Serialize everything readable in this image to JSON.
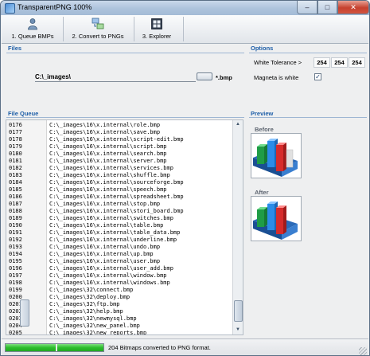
{
  "window": {
    "title": "TransparentPNG 100%"
  },
  "toolbar": {
    "buttons": [
      {
        "label": "1. Queue BMPs",
        "icon": "person-icon"
      },
      {
        "label": "2. Convert to PNGs",
        "icon": "convert-icon"
      },
      {
        "label": "3. Explorer",
        "icon": "explorer-icon"
      }
    ]
  },
  "files": {
    "title": "Files",
    "path_value": "C:\\_images\\",
    "extension": "*.bmp"
  },
  "options": {
    "title": "Options",
    "tolerance_label": "White Tolerance >",
    "tolerance_r": "254",
    "tolerance_g": "254",
    "tolerance_b": "254",
    "magneta_label": "Magneta is white",
    "magneta_checked": true
  },
  "queue": {
    "title": "File Queue",
    "rows": [
      {
        "n": "0176",
        "p": "C:\\_images\\16\\x.internal\\role.bmp"
      },
      {
        "n": "0177",
        "p": "C:\\_images\\16\\x.internal\\save.bmp"
      },
      {
        "n": "0178",
        "p": "C:\\_images\\16\\x.internal\\script-edit.bmp"
      },
      {
        "n": "0179",
        "p": "C:\\_images\\16\\x.internal\\script.bmp"
      },
      {
        "n": "0180",
        "p": "C:\\_images\\16\\x.internal\\search.bmp"
      },
      {
        "n": "0181",
        "p": "C:\\_images\\16\\x.internal\\server.bmp"
      },
      {
        "n": "0182",
        "p": "C:\\_images\\16\\x.internal\\services.bmp"
      },
      {
        "n": "0183",
        "p": "C:\\_images\\16\\x.internal\\shuffle.bmp"
      },
      {
        "n": "0184",
        "p": "C:\\_images\\16\\x.internal\\sourceforge.bmp"
      },
      {
        "n": "0185",
        "p": "C:\\_images\\16\\x.internal\\speech.bmp"
      },
      {
        "n": "0186",
        "p": "C:\\_images\\16\\x.internal\\spreadsheet.bmp"
      },
      {
        "n": "0187",
        "p": "C:\\_images\\16\\x.internal\\stop.bmp"
      },
      {
        "n": "0188",
        "p": "C:\\_images\\16\\x.internal\\stori_board.bmp"
      },
      {
        "n": "0189",
        "p": "C:\\_images\\16\\x.internal\\switches.bmp"
      },
      {
        "n": "0190",
        "p": "C:\\_images\\16\\x.internal\\table.bmp"
      },
      {
        "n": "0191",
        "p": "C:\\_images\\16\\x.internal\\table_data.bmp"
      },
      {
        "n": "0192",
        "p": "C:\\_images\\16\\x.internal\\underline.bmp"
      },
      {
        "n": "0193",
        "p": "C:\\_images\\16\\x.internal\\undo.bmp"
      },
      {
        "n": "0194",
        "p": "C:\\_images\\16\\x.internal\\up.bmp"
      },
      {
        "n": "0195",
        "p": "C:\\_images\\16\\x.internal\\user.bmp"
      },
      {
        "n": "0196",
        "p": "C:\\_images\\16\\x.internal\\user_add.bmp"
      },
      {
        "n": "0197",
        "p": "C:\\_images\\16\\x.internal\\window.bmp"
      },
      {
        "n": "0198",
        "p": "C:\\_images\\16\\x.internal\\windows.bmp"
      },
      {
        "n": "0199",
        "p": "C:\\_images\\32\\connect.bmp"
      },
      {
        "n": "0200",
        "p": "C:\\_images\\32\\deploy.bmp"
      },
      {
        "n": "0201",
        "p": "C:\\_images\\32\\ftp.bmp"
      },
      {
        "n": "0202",
        "p": "C:\\_images\\32\\help.bmp"
      },
      {
        "n": "0203",
        "p": "C:\\_images\\32\\newmysql.bmp"
      },
      {
        "n": "0204",
        "p": "C:\\_images\\32\\new_panel.bmp"
      },
      {
        "n": "0205",
        "p": "C:\\_images\\32\\new_reports.bmp"
      }
    ]
  },
  "preview": {
    "title": "Preview",
    "before_label": "Before",
    "after_label": "After",
    "image_icon": "bar-chart-3d-icon"
  },
  "status": {
    "text": "204 Bitmaps converted to PNG format.",
    "progress": 1.0
  },
  "colors": {
    "section_title": "#1f5fa8",
    "progress_fill": "#2cbd2c"
  }
}
